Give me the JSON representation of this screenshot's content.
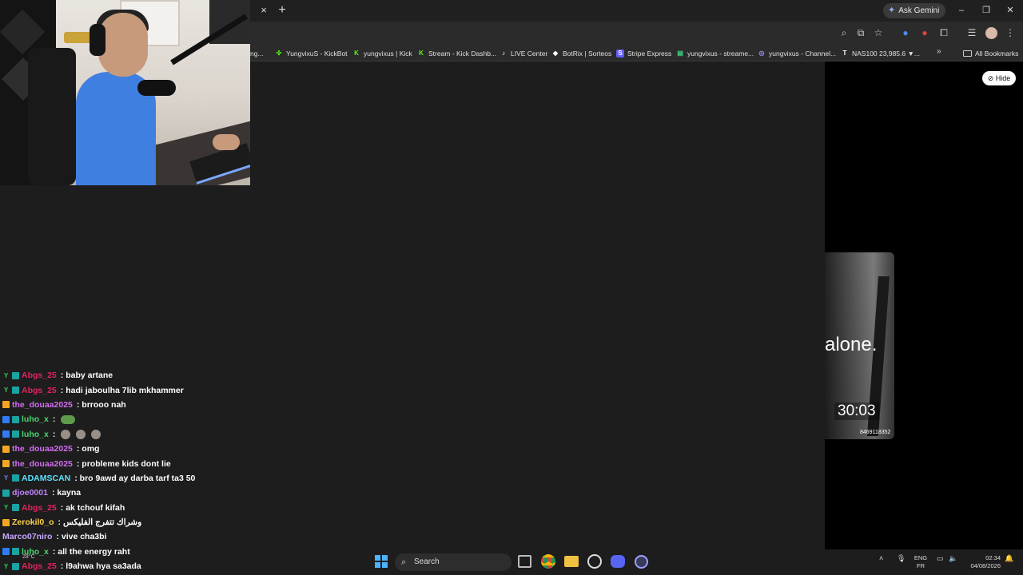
{
  "browser": {
    "tab_close": "×",
    "tab_new": "+",
    "ask_gemini": "Ask Gemini",
    "window_controls": [
      "–",
      "❐",
      "✕"
    ]
  },
  "bookmarks": {
    "items": [
      {
        "label": "ng...",
        "icon": "bookmark-icon",
        "color": "#888888"
      },
      {
        "label": "YungvixuS - KickBot",
        "icon": "kickbot-icon",
        "color": "#53fc18"
      },
      {
        "label": "yungvixus | Kick",
        "icon": "kick-icon",
        "color": "#53fc18"
      },
      {
        "label": "Stream - Kick Dashb...",
        "icon": "kick-icon",
        "color": "#53fc18"
      },
      {
        "label": "LIVE Center",
        "icon": "tiktok-icon",
        "color": "#ffffff"
      },
      {
        "label": "BotRix | Sorteos",
        "icon": "botrix-icon",
        "color": "#ffffff"
      },
      {
        "label": "Stripe Express",
        "icon": "stripe-icon",
        "color": "#635bff"
      },
      {
        "label": "yungvixus - streame...",
        "icon": "streamelements-icon",
        "color": "#3ddc84"
      },
      {
        "label": "yungvixus - Channel...",
        "icon": "channel-icon",
        "color": "#9b8cff"
      },
      {
        "label": "NAS100 23,985.6 ▼...",
        "icon": "tradingview-icon",
        "color": "#ffffff"
      }
    ],
    "more": "»",
    "all_bookmarks": "All Bookmarks"
  },
  "panel": {
    "hide_button": "Hide",
    "caption": "alone.",
    "timer": "30:03",
    "video_id": "8469118352"
  },
  "chat": {
    "messages": [
      {
        "user": "Abgs_25",
        "user_color": "#e0245e",
        "badges": [
          "y",
          "grid"
        ],
        "text": ": baby artane"
      },
      {
        "user": "Abgs_25",
        "user_color": "#e0245e",
        "badges": [
          "y",
          "grid"
        ],
        "text": ": hadi jaboulha 7lib mkhammer"
      },
      {
        "user": "the_douaa2025",
        "user_color": "#d36cf2",
        "badges": [
          "crown"
        ],
        "text": ": brrooo nah"
      },
      {
        "user": "luho_x",
        "user_color": "#4ad66d",
        "badges": [
          "blue",
          "grid"
        ],
        "text": ":",
        "emotes": [
          "frog"
        ]
      },
      {
        "user": "luho_x",
        "user_color": "#4ad66d",
        "badges": [
          "blue",
          "grid"
        ],
        "text": ":",
        "emotes": [
          "face",
          "face",
          "face"
        ]
      },
      {
        "user": "the_douaa2025",
        "user_color": "#d36cf2",
        "badges": [
          "crown"
        ],
        "text": ": omg"
      },
      {
        "user": "the_douaa2025",
        "user_color": "#d36cf2",
        "badges": [
          "crown"
        ],
        "text": ": probleme kids dont lie"
      },
      {
        "user": "ADAMSCAN",
        "user_color": "#5be3ff",
        "badges": [
          "ylw",
          "grid"
        ],
        "text": ": bro 9awd ay darba tarf ta3 50"
      },
      {
        "user": "djoe0001",
        "user_color": "#c084fc",
        "badges": [
          "grid"
        ],
        "text": ": kayna"
      },
      {
        "user": "Abgs_25",
        "user_color": "#e0245e",
        "badges": [
          "y",
          "grid"
        ],
        "text": ": ak tchouf kifah"
      },
      {
        "user": "Zerokil0_o",
        "user_color": "#ffd24a",
        "badges": [
          "crown"
        ],
        "text": ": وشراك تتفرج الفليكس"
      },
      {
        "user": "Marco07niro",
        "user_color": "#c9a7ff",
        "badges": [],
        "text": ": vive cha3bi"
      },
      {
        "user": "luho_x",
        "user_color": "#4ad66d",
        "badges": [
          "blue",
          "grid"
        ],
        "text": ": all the energy raht"
      },
      {
        "user": "Abgs_25",
        "user_color": "#e0245e",
        "badges": [
          "y",
          "grid"
        ],
        "text": ": l9ahwa hya sa3ada"
      }
    ]
  },
  "taskbar": {
    "weather": "28°C",
    "search_label": "Search",
    "lang_top": "ENG",
    "lang_bottom": "FR",
    "time": "02:34",
    "date": "04/08/2026"
  }
}
